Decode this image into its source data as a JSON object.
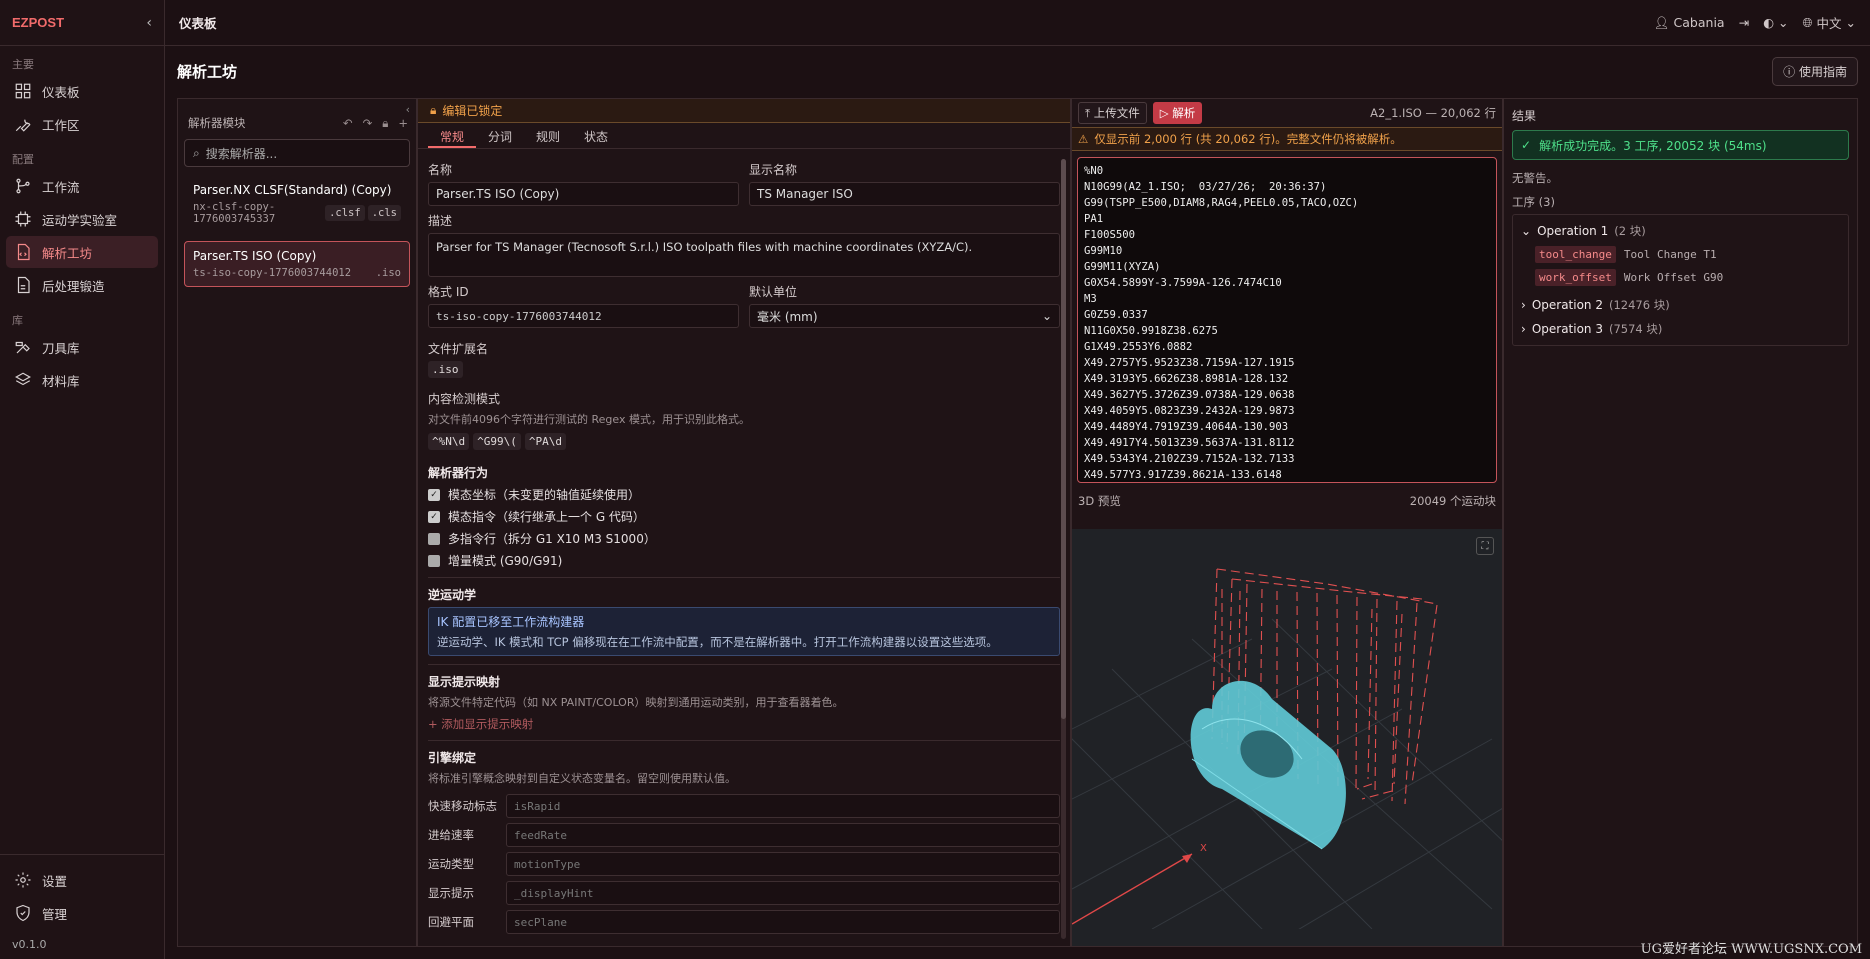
{
  "brand": "EZPOST",
  "sidebar": {
    "sections": [
      {
        "title": "主要",
        "items": [
          {
            "label": "仪表板",
            "icon": "grid-icon"
          },
          {
            "label": "工作区",
            "icon": "wrench-icon"
          }
        ]
      },
      {
        "title": "配置",
        "items": [
          {
            "label": "工作流",
            "icon": "workflow-icon"
          },
          {
            "label": "运动学实验室",
            "icon": "chip-icon"
          },
          {
            "label": "解析工坊",
            "icon": "file-code-icon",
            "active": true
          },
          {
            "label": "后处理锻造",
            "icon": "file-icon"
          }
        ]
      },
      {
        "title": "库",
        "items": [
          {
            "label": "刀具库",
            "icon": "tool-icon"
          },
          {
            "label": "材料库",
            "icon": "layers-icon"
          }
        ]
      }
    ],
    "bottom": [
      {
        "label": "设置"
      },
      {
        "label": "管理"
      }
    ],
    "version": "v0.1.0"
  },
  "topbar": {
    "crumb": "仪表板",
    "user": "Cabania",
    "lang": "中文"
  },
  "page": {
    "title": "解析工坊",
    "guide": "使用指南"
  },
  "modules": {
    "title": "解析器模块",
    "search_placeholder": "搜索解析器...",
    "items": [
      {
        "name": "Parser.NX CLSF(Standard) (Copy)",
        "id1": "nx-clsf-copy-",
        "id2": "1776003745337",
        "exts": [
          ".clsf",
          ".cls"
        ]
      },
      {
        "name": "Parser.TS ISO (Copy)",
        "id1": "ts-iso-copy-1776003744012",
        "exts": [
          ".iso"
        ]
      }
    ]
  },
  "editor": {
    "locked": "编辑已锁定",
    "tabs": [
      "常规",
      "分词",
      "规则",
      "状态"
    ],
    "name_label": "名称",
    "name_value": "Parser.TS ISO (Copy)",
    "display_label": "显示名称",
    "display_value": "TS Manager ISO",
    "desc_label": "描述",
    "desc_value": "Parser for TS Manager (Tecnosoft S.r.l.) ISO toolpath files with machine coordinates (XYZA/C).",
    "format_label": "格式 ID",
    "format_value": "ts-iso-copy-1776003744012",
    "unit_label": "默认单位",
    "unit_value": "毫米 (mm)",
    "ext_label": "文件扩展名",
    "ext_value": ".iso",
    "detect_label": "内容检测模式",
    "detect_hint": "对文件前4096个字符进行测试的 Regex 模式，用于识别此格式。",
    "detect_patterns": [
      "^%N\\d",
      "^G99\\(",
      "^PA\\d"
    ],
    "behavior_title": "解析器行为",
    "behaviors": [
      {
        "label": "模态坐标（未变更的轴值延续使用）",
        "checked": true
      },
      {
        "label": "模态指令（续行继承上一个 G 代码）",
        "checked": true
      },
      {
        "label": "多指令行（拆分 G1 X10 M3 S1000）",
        "checked": false
      },
      {
        "label": "增量模式 (G90/G91)",
        "checked": false
      }
    ],
    "ik_title": "逆运动学",
    "ik_box_title": "IK 配置已移至工作流构建器",
    "ik_box_text": "逆运动学、IK 模式和 TCP 偏移现在在工作流中配置，而不是在解析器中。打开工作流构建器以设置这些选项。",
    "hint_title": "显示提示映射",
    "hint_desc": "将源文件特定代码（如 NX PAINT/COLOR）映射到通用运动类别，用于查看器着色。",
    "hint_add": "+ 添加显示提示映射",
    "bind_title": "引擎绑定",
    "bind_desc": "将标准引擎概念映射到自定义状态变量名。留空则使用默认值。",
    "bindings": [
      {
        "label": "快速移动标志",
        "placeholder": "isRapid"
      },
      {
        "label": "进给速率",
        "placeholder": "feedRate"
      },
      {
        "label": "运动类型",
        "placeholder": "motionType"
      },
      {
        "label": "显示提示",
        "placeholder": "_displayHint"
      },
      {
        "label": "回避平面",
        "placeholder": "secPlane"
      }
    ]
  },
  "source": {
    "upload": "上传文件",
    "parse": "解析",
    "file_info": "A2_1.ISO — 20,062 行",
    "warning": "仅显示前 2,000 行 (共 20,062 行)。完整文件仍将被解析。",
    "lines": [
      "%N0",
      "N10G99(A2_1.ISO;  03/27/26;  20:36:37)",
      "G99(TSPP_E500,DIAM8,RAG4,PEEL0.05,TACO,OZC)",
      "PA1",
      "F100S500",
      "G99M10",
      "G99M11(XYZA)",
      "G0X54.5899Y-3.7599A-126.7474C10",
      "M3",
      "G0Z59.0337",
      "N11G0X50.9918Z38.6275",
      "G1X49.2553Y6.0882",
      "X49.2757Y5.9523Z38.7159A-127.1915",
      "X49.3193Y5.6626Z38.8981A-128.132",
      "X49.3627Y5.3726Z39.0738A-129.0638",
      "X49.4059Y5.0823Z39.2432A-129.9873",
      "X49.4489Y4.7919Z39.4064A-130.903",
      "X49.4917Y4.5013Z39.5637A-131.8112",
      "X49.5343Y4.2102Z39.7152A-132.7133",
      "X49.577Y3.917Z39.8621A-133.6148"
    ],
    "preview_label": "3D 预览",
    "preview_count": "20049 个运动块",
    "axis_x": "X"
  },
  "results": {
    "title": "结果",
    "success": "解析成功完成。3 工序, 20052 块",
    "success_time": "(54ms)",
    "no_warnings": "无警告。",
    "ops_label": "工序 (3)",
    "operations": [
      {
        "name": "Operation 1",
        "count": "(2 块)",
        "expanded": true,
        "children": [
          {
            "key": "tool_change",
            "value": "Tool Change T1"
          },
          {
            "key": "work_offset",
            "value": "Work Offset G90"
          }
        ]
      },
      {
        "name": "Operation 2",
        "count": "(12476 块)",
        "expanded": false
      },
      {
        "name": "Operation 3",
        "count": "(7574 块)",
        "expanded": false
      }
    ]
  },
  "watermark": "UG爱好者论坛 WWW.UGSNX.COM"
}
